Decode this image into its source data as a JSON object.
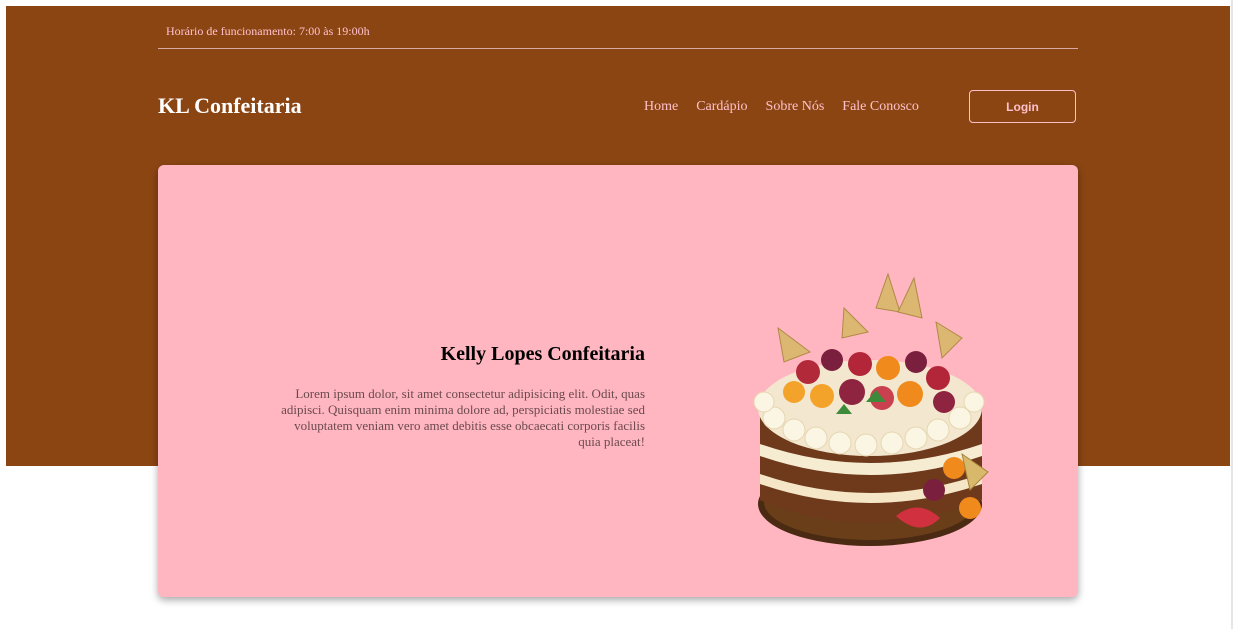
{
  "topbar": {
    "hours_text": "Horário de funcionamento: 7:00 às 19:00h"
  },
  "header": {
    "brand": "KL Confeitaria",
    "nav": [
      "Home",
      "Cardápio",
      "Sobre Nós",
      "Fale Conosco"
    ],
    "login_label": "Login"
  },
  "hero": {
    "title": "Kelly Lopes Confeitaria",
    "description": "Lorem ipsum dolor, sit amet consectetur adipisicing elit. Odit, quas adipisci. Quisquam enim minima dolore ad, perspiciatis molestiae sed voluptatem veniam vero amet debitis esse obcaecati corporis facilis quia placeat!",
    "image_subject": "naked cake with fruits"
  },
  "colors": {
    "header_background": "#8b4513",
    "accent_pink": "#ffc0cb",
    "hero_background": "#ffb6c1",
    "brand_text": "#ffffff"
  }
}
